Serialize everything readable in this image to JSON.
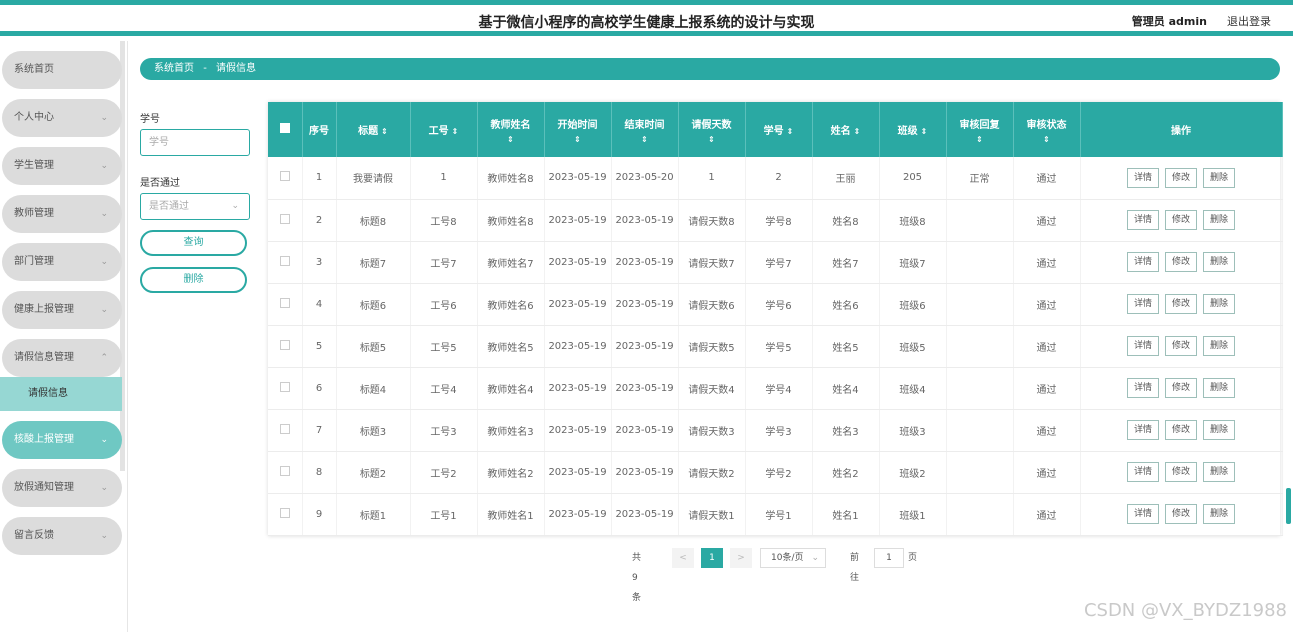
{
  "header": {
    "title": "基于微信小程序的高校学生健康上报系统的设计与实现",
    "user": "管理员 admin",
    "logout": "退出登录"
  },
  "sidebar": {
    "items": [
      {
        "label": "系统首页",
        "chevron": ""
      },
      {
        "label": "个人中心",
        "chevron": "⌄"
      },
      {
        "label": "学生管理",
        "chevron": "⌄"
      },
      {
        "label": "教师管理",
        "chevron": "⌄"
      },
      {
        "label": "部门管理",
        "chevron": "⌄"
      },
      {
        "label": "健康上报管理",
        "chevron": "⌄"
      },
      {
        "label": "请假信息管理",
        "chevron": "⌃"
      },
      {
        "label": "核酸上报管理",
        "chevron": "⌄"
      },
      {
        "label": "放假通知管理",
        "chevron": "⌄"
      },
      {
        "label": "留言反馈",
        "chevron": "⌄"
      }
    ],
    "submenu": "请假信息"
  },
  "breadcrumb": {
    "home": "系统首页",
    "sep": "-",
    "current": "请假信息"
  },
  "filters": {
    "student_no_label": "学号",
    "student_no_placeholder": "学号",
    "approved_label": "是否通过",
    "approved_placeholder": "是否通过",
    "query": "查询",
    "delete": "删除"
  },
  "table": {
    "headers": {
      "index": "序号",
      "title": "标题",
      "work_no": "工号",
      "teacher_name": "教师姓名",
      "start_time": "开始时间",
      "end_time": "结束时间",
      "leave_days": "请假天数",
      "student_no": "学号",
      "name": "姓名",
      "class": "班级",
      "reply": "审核回复",
      "status": "审核状态",
      "ops": "操作"
    },
    "sort_icon": "⇕",
    "ops": {
      "detail": "详情",
      "edit": "修改",
      "delete": "删除"
    },
    "rows": [
      {
        "index": "1",
        "title": "我要请假",
        "work_no": "1",
        "teacher_name": "教师姓名8",
        "start_time": "2023-05-19",
        "end_time": "2023-05-20",
        "leave_days": "1",
        "student_no": "2",
        "name": "王丽",
        "class": "205",
        "reply": "正常",
        "status": "通过"
      },
      {
        "index": "2",
        "title": "标题8",
        "work_no": "工号8",
        "teacher_name": "教师姓名8",
        "start_time": "2023-05-19",
        "end_time": "2023-05-19",
        "leave_days": "请假天数8",
        "student_no": "学号8",
        "name": "姓名8",
        "class": "班级8",
        "reply": "",
        "status": "通过"
      },
      {
        "index": "3",
        "title": "标题7",
        "work_no": "工号7",
        "teacher_name": "教师姓名7",
        "start_time": "2023-05-19",
        "end_time": "2023-05-19",
        "leave_days": "请假天数7",
        "student_no": "学号7",
        "name": "姓名7",
        "class": "班级7",
        "reply": "",
        "status": "通过"
      },
      {
        "index": "4",
        "title": "标题6",
        "work_no": "工号6",
        "teacher_name": "教师姓名6",
        "start_time": "2023-05-19",
        "end_time": "2023-05-19",
        "leave_days": "请假天数6",
        "student_no": "学号6",
        "name": "姓名6",
        "class": "班级6",
        "reply": "",
        "status": "通过"
      },
      {
        "index": "5",
        "title": "标题5",
        "work_no": "工号5",
        "teacher_name": "教师姓名5",
        "start_time": "2023-05-19",
        "end_time": "2023-05-19",
        "leave_days": "请假天数5",
        "student_no": "学号5",
        "name": "姓名5",
        "class": "班级5",
        "reply": "",
        "status": "通过"
      },
      {
        "index": "6",
        "title": "标题4",
        "work_no": "工号4",
        "teacher_name": "教师姓名4",
        "start_time": "2023-05-19",
        "end_time": "2023-05-19",
        "leave_days": "请假天数4",
        "student_no": "学号4",
        "name": "姓名4",
        "class": "班级4",
        "reply": "",
        "status": "通过"
      },
      {
        "index": "7",
        "title": "标题3",
        "work_no": "工号3",
        "teacher_name": "教师姓名3",
        "start_time": "2023-05-19",
        "end_time": "2023-05-19",
        "leave_days": "请假天数3",
        "student_no": "学号3",
        "name": "姓名3",
        "class": "班级3",
        "reply": "",
        "status": "通过"
      },
      {
        "index": "8",
        "title": "标题2",
        "work_no": "工号2",
        "teacher_name": "教师姓名2",
        "start_time": "2023-05-19",
        "end_time": "2023-05-19",
        "leave_days": "请假天数2",
        "student_no": "学号2",
        "name": "姓名2",
        "class": "班级2",
        "reply": "",
        "status": "通过"
      },
      {
        "index": "9",
        "title": "标题1",
        "work_no": "工号1",
        "teacher_name": "教师姓名1",
        "start_time": "2023-05-19",
        "end_time": "2023-05-19",
        "leave_days": "请假天数1",
        "student_no": "学号1",
        "name": "姓名1",
        "class": "班级1",
        "reply": "",
        "status": "通过"
      }
    ]
  },
  "pager": {
    "total": "共 9 条",
    "prev": "<",
    "current": "1",
    "next": ">",
    "page_size": "10条/页",
    "goto_prefix": "前往",
    "goto_value": "1",
    "goto_suffix": "页"
  },
  "watermark": "CSDN @VX_BYDZ1988",
  "colors": {
    "accent": "#2aa9a3",
    "active_menu": "#6fc8c3",
    "submenu": "#96d7d3"
  }
}
